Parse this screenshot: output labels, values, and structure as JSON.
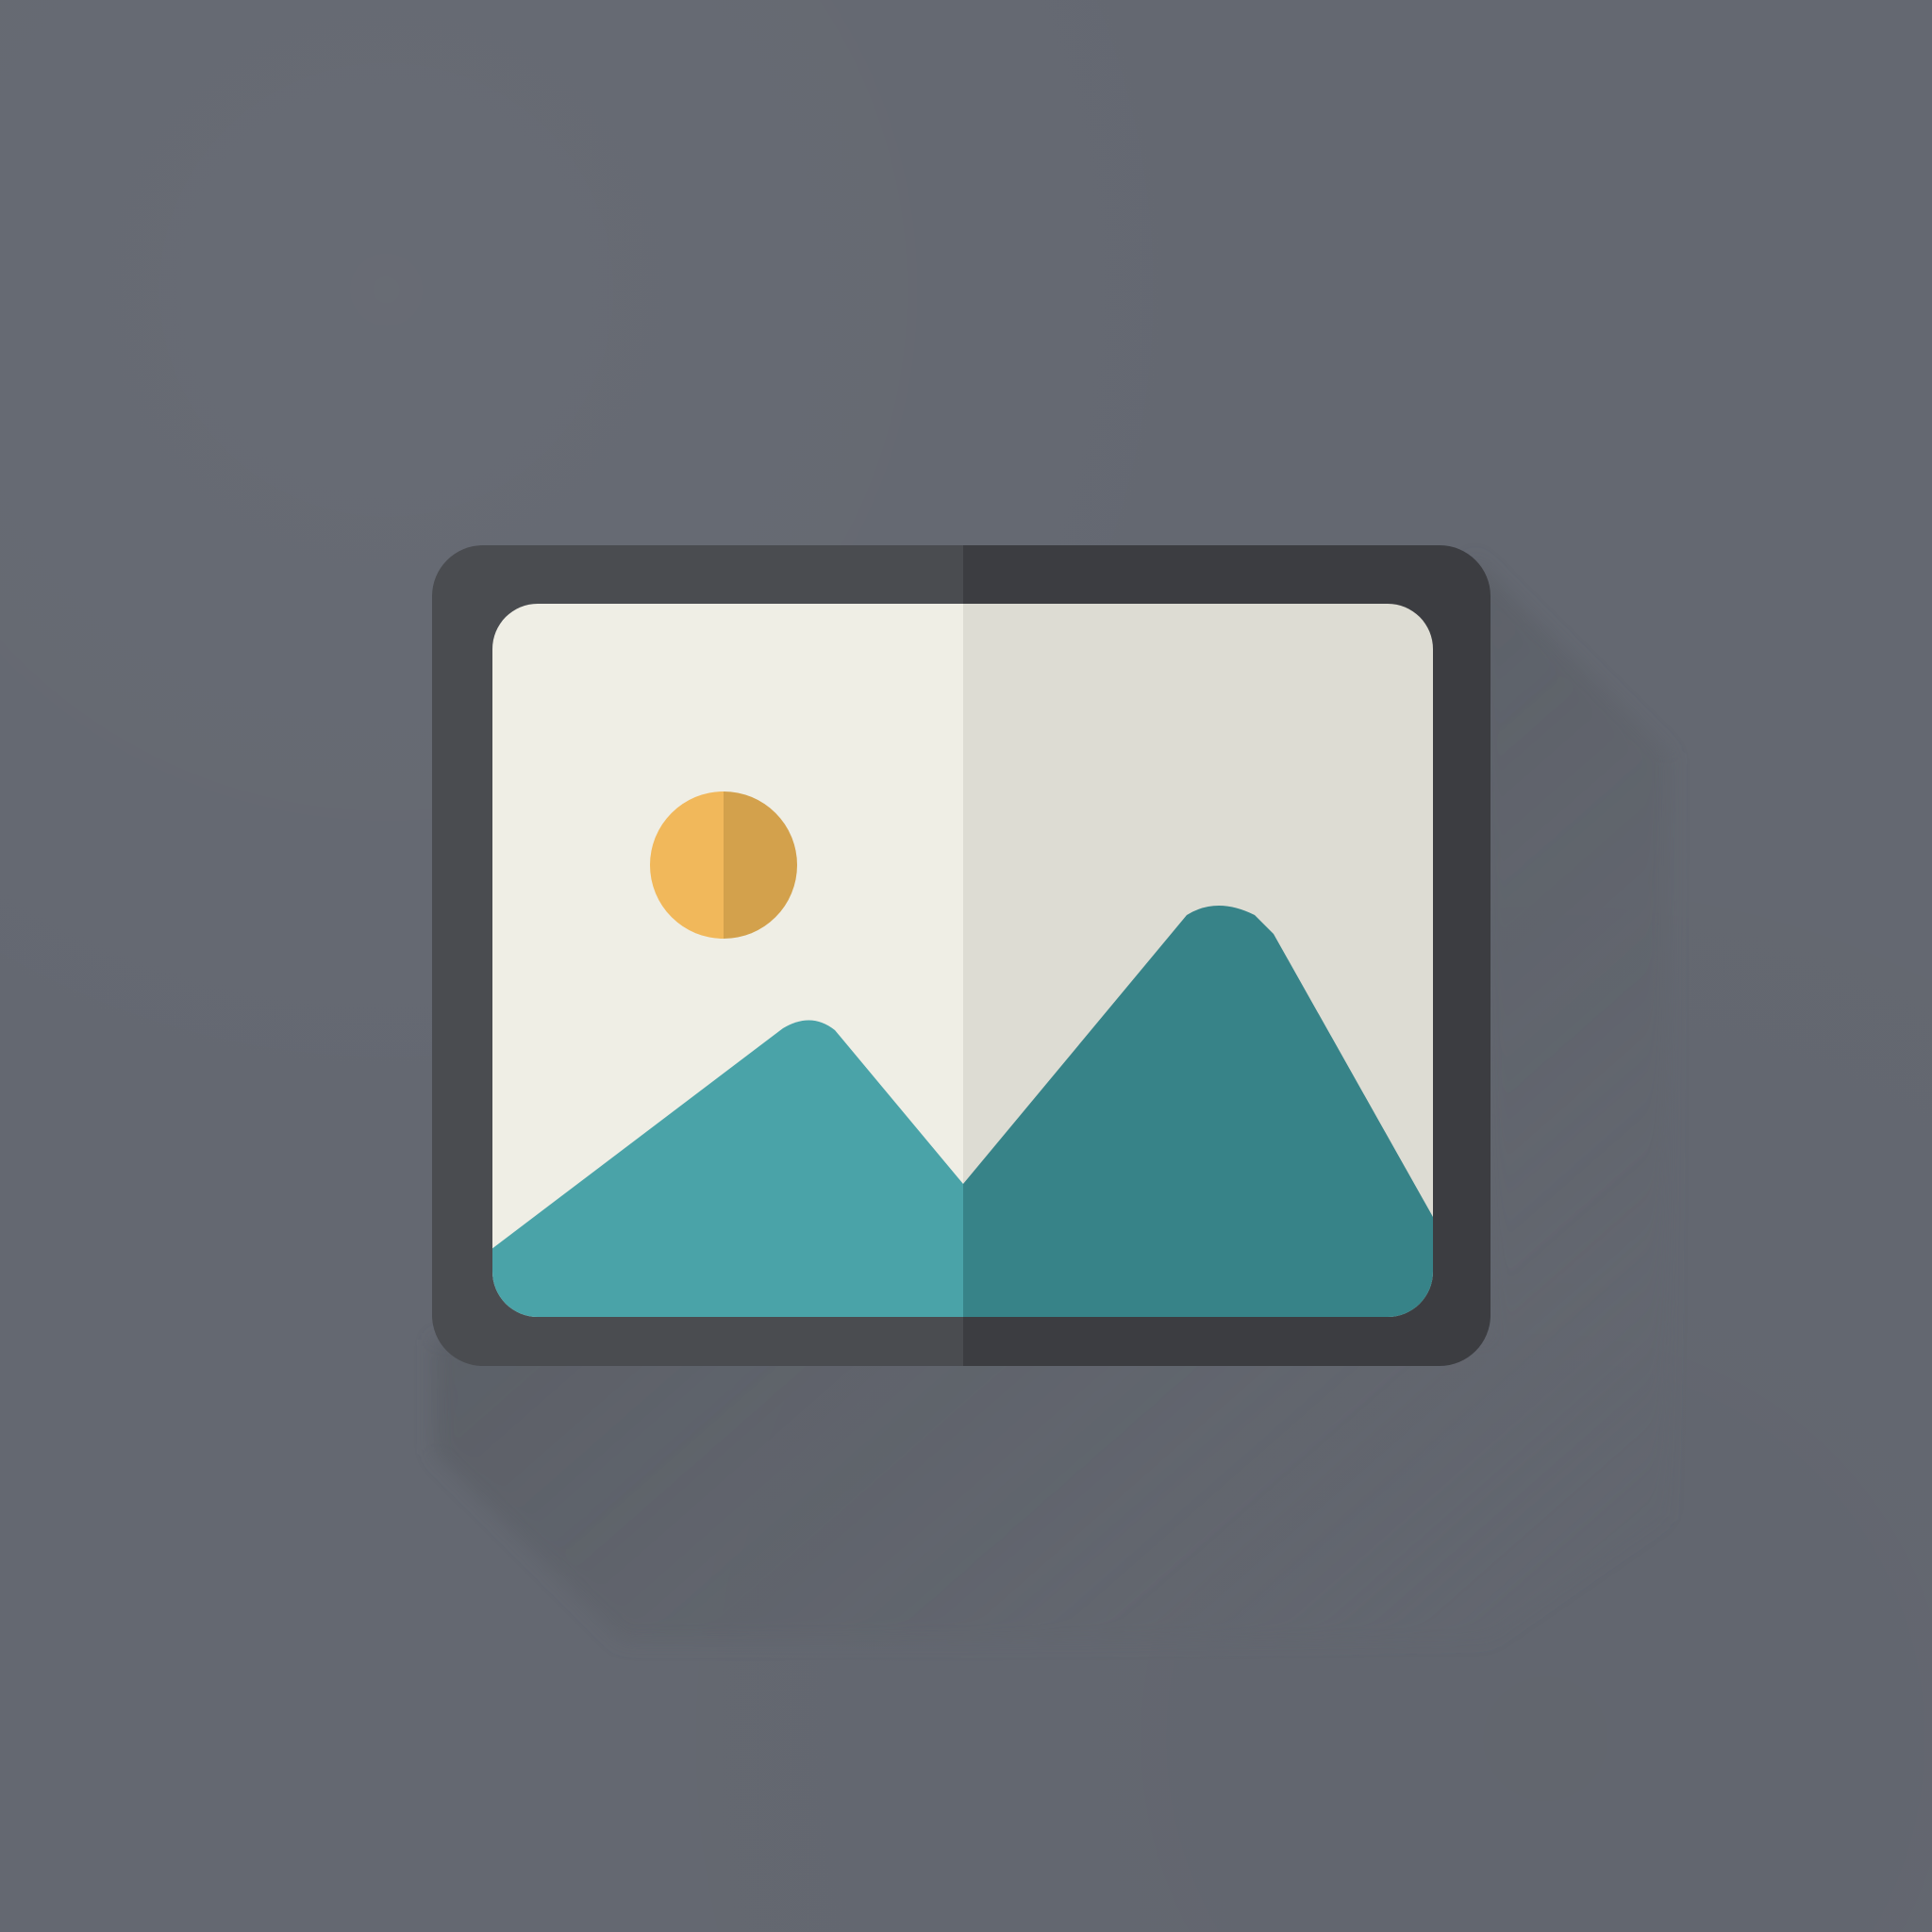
{
  "scene": {
    "icon_name": "image-placeholder-icon",
    "elements": {
      "background": "plain-background",
      "frame": "picture-frame",
      "sun": "sun-icon",
      "mountains": "mountain-icon"
    }
  },
  "colors": {
    "background": "#646871",
    "long_shadow": "#4f5359",
    "frame_left": "#4a4c50",
    "frame_right": "#3c3d41",
    "sky_left": "#efeee5",
    "sky_right": "#dddcd3",
    "mountain_left": "#4aa3a8",
    "mountain_right": "#378388",
    "sun_left": "#f1b85b",
    "sun_right": "#d3a14c"
  }
}
